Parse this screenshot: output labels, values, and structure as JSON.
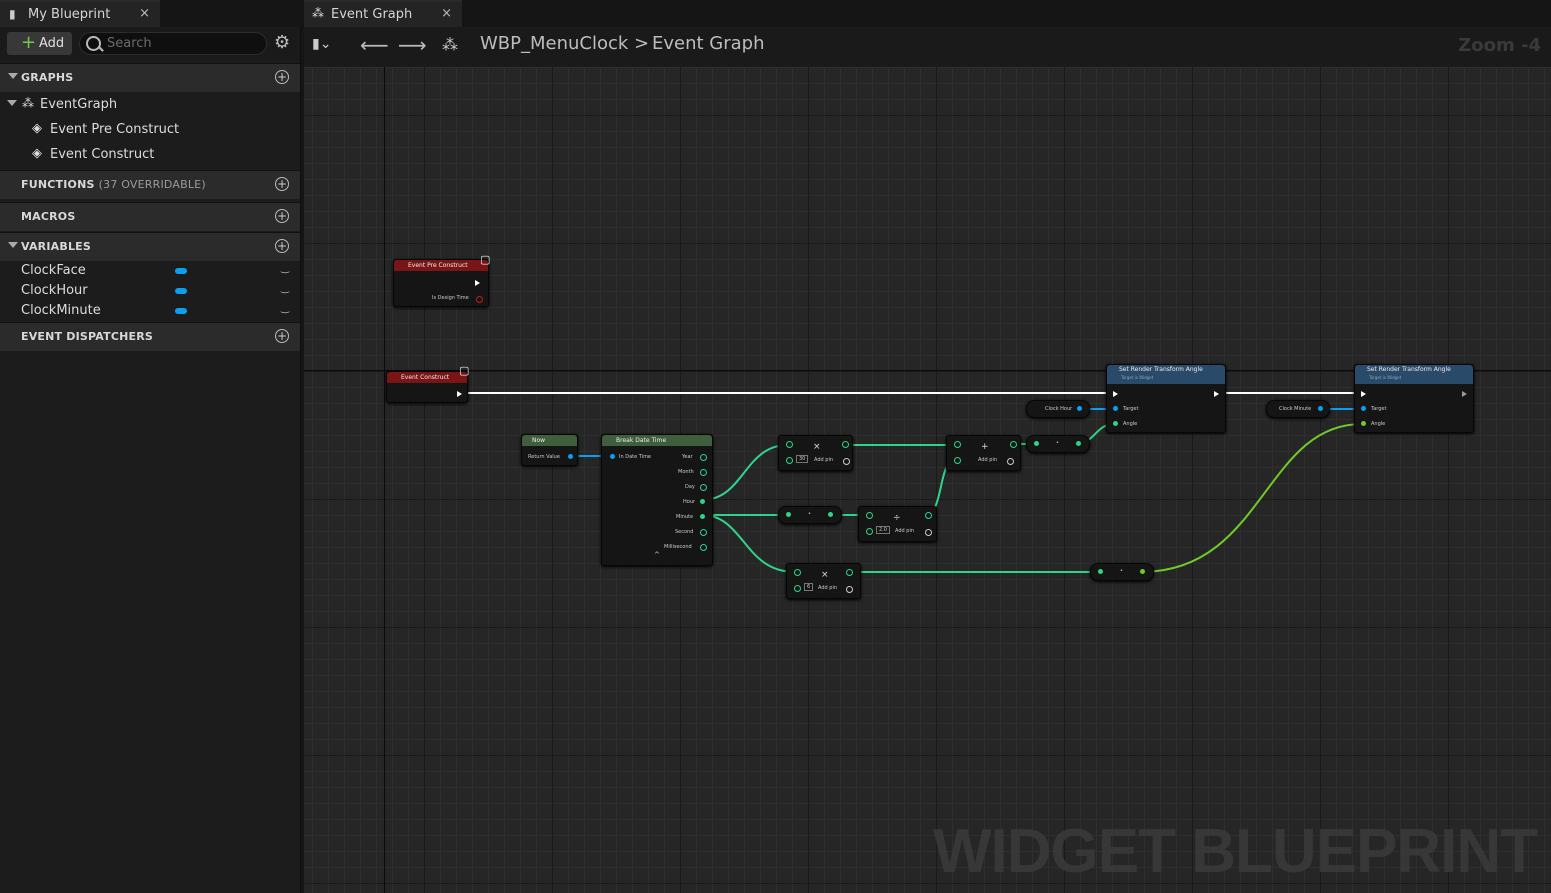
{
  "tabs": {
    "left_tab": "My Blueprint",
    "graph_tab": "Event Graph",
    "close": "×"
  },
  "toolbar": {
    "add_label": "Add",
    "search_placeholder": "Search"
  },
  "sections": {
    "graphs": "GRAPHS",
    "functions": "FUNCTIONS",
    "functions_sub": "(37 OVERRIDABLE)",
    "macros": "MACROS",
    "variables": "VARIABLES",
    "dispatchers": "EVENT DISPATCHERS"
  },
  "graph_tree": {
    "root": "EventGraph",
    "children": [
      "Event Pre Construct",
      "Event Construct"
    ]
  },
  "variables": [
    "ClockFace",
    "ClockHour",
    "ClockMinute"
  ],
  "breadcrumb": {
    "asset": "WBP_MenuClock",
    "graph": "Event Graph",
    "separator": ">"
  },
  "zoom": "Zoom -4",
  "watermark": "WIDGET BLUEPRINT",
  "nodes": {
    "pre_construct": {
      "title": "Event Pre Construct",
      "pin": "Is Design Time"
    },
    "construct": {
      "title": "Event Construct"
    },
    "now": {
      "title": "Now",
      "pin": "Return Value"
    },
    "break_dt": {
      "title": "Break Date Time",
      "in": "In Date Time",
      "outs": [
        "Year",
        "Month",
        "Day",
        "Hour",
        "Minute",
        "Second",
        "Millisecond"
      ]
    },
    "mul1": {
      "op": "×",
      "const": "30",
      "add": "Add pin"
    },
    "add1": {
      "op": "+",
      "add": "Add pin"
    },
    "div1": {
      "op": "÷",
      "const": "2.0",
      "add": "Add pin"
    },
    "mul2": {
      "op": "×",
      "const": "6",
      "add": "Add pin"
    },
    "dot": "•",
    "clock_hour_get": "Clock Hour",
    "clock_minute_get": "Clock Minute",
    "set1": {
      "title": "Set Render Transform Angle",
      "sub": "Target is Widget",
      "target": "Target",
      "angle": "Angle"
    },
    "set2": {
      "title": "Set Render Transform Angle",
      "sub": "Target is Widget",
      "target": "Target",
      "angle": "Angle"
    }
  },
  "colors": {
    "exec": "#ffffff",
    "float": "#2fd48a",
    "object": "#0aa0f0",
    "event_header": "#7a1515",
    "call_header": "#2a4a6a"
  }
}
